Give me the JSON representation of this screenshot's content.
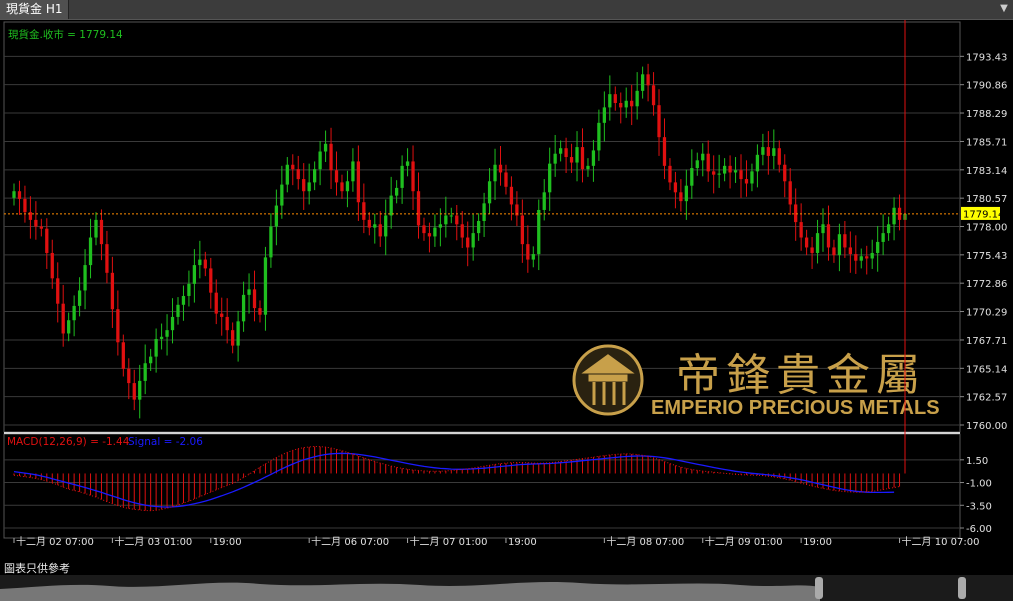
{
  "window": {
    "tab_title": "現貨金 H1"
  },
  "price_panel": {
    "readout": "現貨金.收市 = 1779.14"
  },
  "macd_panel": {
    "label_main": "MACD(12,26,9) = -1.44",
    "label_signal": "Signal = -2.06"
  },
  "watermark": {
    "brand_cn": "帝鋒貴金屬",
    "brand_en": "EMPERIO PRECIOUS METALS"
  },
  "footer": {
    "note": "圖表只供參考"
  },
  "colors": {
    "bull": "#1fbf1f",
    "bear": "#e01010",
    "macd_hist": "#e01010",
    "signal": "#1a1aff",
    "current_price": "#ffff00",
    "current_line": "#ff8c00",
    "grid": "#3a3a3a",
    "text": "#e0e0e0",
    "brand_gold": "#c8a04a"
  },
  "chart_data": [
    {
      "type": "candlestick",
      "title": "現貨金 H1",
      "series_name": "現貨金.收市",
      "current_value": 1779.14,
      "current_label": "1779.14",
      "ylim": [
        1760.0,
        1796.0
      ],
      "y_ticks": [
        1793.43,
        1790.86,
        1788.29,
        1785.71,
        1783.14,
        1780.57,
        1778.0,
        1775.43,
        1772.86,
        1770.29,
        1767.71,
        1765.14,
        1762.57,
        1760.0
      ],
      "y_tick_labels": [
        "1793.43",
        "1790.86",
        "1788.29",
        "1785.71",
        "1783.14",
        "1780.57",
        "1778.00",
        "1775.43",
        "1772.86",
        "1770.29",
        "1767.71",
        "1765.14",
        "1762.57",
        "1760.00"
      ],
      "x_ticks": [
        {
          "index": 0,
          "label": "十二月 02 07:00"
        },
        {
          "index": 18,
          "label": "十二月 03 01:00"
        },
        {
          "index": 36,
          "label": "19:00"
        },
        {
          "index": 54,
          "label": "十二月 06 07:00"
        },
        {
          "index": 72,
          "label": "十二月 07 01:00"
        },
        {
          "index": 90,
          "label": "19:00"
        },
        {
          "index": 108,
          "label": "十二月 08 07:00"
        },
        {
          "index": 126,
          "label": "十二月 09 01:00"
        },
        {
          "index": 144,
          "label": "19:00"
        },
        {
          "index": 162,
          "label": "十二月 10 07:00"
        }
      ],
      "close": [
        1781.2,
        1780.5,
        1779.3,
        1778.6,
        1778.0,
        1777.8,
        1775.6,
        1773.3,
        1771.0,
        1768.3,
        1769.5,
        1770.8,
        1772.2,
        1774.5,
        1777.0,
        1778.6,
        1776.4,
        1773.8,
        1770.5,
        1767.5,
        1765.1,
        1763.8,
        1762.3,
        1764.0,
        1765.6,
        1766.2,
        1767.8,
        1768.0,
        1768.6,
        1769.8,
        1770.9,
        1771.7,
        1772.8,
        1774.5,
        1775.0,
        1774.2,
        1772.0,
        1770.1,
        1769.8,
        1768.6,
        1767.2,
        1769.4,
        1771.8,
        1772.3,
        1770.6,
        1770.0,
        1775.2,
        1778.0,
        1779.9,
        1781.8,
        1783.6,
        1783.2,
        1782.3,
        1781.2,
        1782.0,
        1783.2,
        1784.8,
        1785.5,
        1783.1,
        1782.0,
        1781.2,
        1782.1,
        1783.9,
        1780.2,
        1778.6,
        1777.9,
        1778.2,
        1777.1,
        1779.0,
        1780.8,
        1781.5,
        1783.5,
        1783.9,
        1781.2,
        1778.1,
        1777.4,
        1777.1,
        1777.9,
        1778.2,
        1779.0,
        1779.0,
        1778.2,
        1777.0,
        1776.1,
        1777.4,
        1778.5,
        1780.1,
        1782.1,
        1783.6,
        1782.9,
        1781.6,
        1780.0,
        1779.0,
        1776.4,
        1775.0,
        1775.5,
        1779.5,
        1781.1,
        1783.7,
        1784.6,
        1785.1,
        1784.3,
        1783.8,
        1785.2,
        1783.2,
        1783.5,
        1784.9,
        1787.4,
        1788.8,
        1790.0,
        1789.2,
        1788.8,
        1789.4,
        1788.9,
        1790.3,
        1791.8,
        1790.8,
        1789.0,
        1786.1,
        1783.5,
        1782.0,
        1781.1,
        1780.3,
        1781.7,
        1783.3,
        1784.0,
        1784.6,
        1783.0,
        1782.7,
        1782.8,
        1783.5,
        1782.9,
        1783.1,
        1782.3,
        1781.9,
        1783.0,
        1784.5,
        1785.2,
        1784.4,
        1785.1,
        1783.6,
        1782.1,
        1780.0,
        1778.4,
        1777.0,
        1776.1,
        1775.6,
        1777.4,
        1778.2,
        1776.1,
        1775.4,
        1777.3,
        1776.1,
        1775.5,
        1774.9,
        1775.3,
        1775.1,
        1775.6,
        1776.6,
        1777.4,
        1778.2,
        1779.7,
        1778.6,
        1779.14
      ],
      "macd": [
        -0.2,
        -0.28,
        -0.36,
        -0.45,
        -0.55,
        -0.68,
        -0.85,
        -1.05,
        -1.25,
        -1.5,
        -1.72,
        -1.88,
        -2.02,
        -2.2,
        -2.4,
        -2.6,
        -2.85,
        -3.1,
        -3.32,
        -3.55,
        -3.72,
        -3.85,
        -3.95,
        -4.02,
        -4.08,
        -4.1,
        -4.05,
        -3.95,
        -3.82,
        -3.65,
        -3.45,
        -3.25,
        -3.05,
        -2.8,
        -2.55,
        -2.3,
        -2.05,
        -1.8,
        -1.55,
        -1.32,
        -1.1,
        -0.8,
        -0.45,
        -0.1,
        0.3,
        0.7,
        1.05,
        1.4,
        1.75,
        2.05,
        2.32,
        2.55,
        2.72,
        2.84,
        2.92,
        2.96,
        2.95,
        2.9,
        2.8,
        2.66,
        2.5,
        2.32,
        2.12,
        1.92,
        1.72,
        1.52,
        1.32,
        1.14,
        0.98,
        0.82,
        0.68,
        0.56,
        0.46,
        0.38,
        0.32,
        0.28,
        0.25,
        0.24,
        0.25,
        0.28,
        0.32,
        0.38,
        0.44,
        0.52,
        0.6,
        0.7,
        0.8,
        0.9,
        1.0,
        1.08,
        1.14,
        1.18,
        1.2,
        1.2,
        1.18,
        1.14,
        1.12,
        1.14,
        1.18,
        1.24,
        1.32,
        1.4,
        1.48,
        1.56,
        1.64,
        1.72,
        1.8,
        1.88,
        1.96,
        2.04,
        2.1,
        2.14,
        2.16,
        2.14,
        2.08,
        2.0,
        1.88,
        1.72,
        1.52,
        1.3,
        1.08,
        0.88,
        0.7,
        0.56,
        0.44,
        0.34,
        0.26,
        0.2,
        0.14,
        0.08,
        0.02,
        -0.04,
        -0.1,
        -0.14,
        -0.16,
        -0.18,
        -0.2,
        -0.24,
        -0.3,
        -0.38,
        -0.48,
        -0.6,
        -0.74,
        -0.9,
        -1.06,
        -1.22,
        -1.38,
        -1.52,
        -1.64,
        -1.76,
        -1.86,
        -1.94,
        -2.0,
        -2.04,
        -2.06,
        -2.06,
        -2.02,
        -1.96,
        -1.88,
        -1.78,
        -1.66,
        -1.54,
        -1.44
      ],
      "signal": [
        0.2,
        0.12,
        0.04,
        -0.05,
        -0.15,
        -0.28,
        -0.42,
        -0.58,
        -0.74,
        -0.9,
        -1.06,
        -1.22,
        -1.38,
        -1.55,
        -1.72,
        -1.9,
        -2.08,
        -2.28,
        -2.48,
        -2.68,
        -2.88,
        -3.06,
        -3.22,
        -3.36,
        -3.48,
        -3.58,
        -3.64,
        -3.68,
        -3.7,
        -3.68,
        -3.64,
        -3.56,
        -3.46,
        -3.34,
        -3.2,
        -3.04,
        -2.86,
        -2.66,
        -2.46,
        -2.24,
        -2.02,
        -1.78,
        -1.52,
        -1.26,
        -0.98,
        -0.7,
        -0.4,
        -0.1,
        0.2,
        0.5,
        0.78,
        1.04,
        1.28,
        1.5,
        1.68,
        1.84,
        1.98,
        2.08,
        2.16,
        2.2,
        2.22,
        2.2,
        2.16,
        2.1,
        2.02,
        1.92,
        1.82,
        1.7,
        1.58,
        1.46,
        1.34,
        1.22,
        1.1,
        0.98,
        0.88,
        0.78,
        0.7,
        0.62,
        0.56,
        0.52,
        0.48,
        0.46,
        0.46,
        0.48,
        0.5,
        0.54,
        0.58,
        0.64,
        0.7,
        0.76,
        0.82,
        0.88,
        0.94,
        0.98,
        1.02,
        1.04,
        1.06,
        1.08,
        1.1,
        1.14,
        1.18,
        1.22,
        1.28,
        1.34,
        1.4,
        1.46,
        1.52,
        1.58,
        1.64,
        1.7,
        1.76,
        1.82,
        1.86,
        1.9,
        1.92,
        1.92,
        1.9,
        1.86,
        1.8,
        1.72,
        1.62,
        1.5,
        1.38,
        1.26,
        1.14,
        1.02,
        0.9,
        0.78,
        0.66,
        0.54,
        0.44,
        0.34,
        0.24,
        0.16,
        0.08,
        0.02,
        -0.04,
        -0.1,
        -0.16,
        -0.22,
        -0.3,
        -0.38,
        -0.48,
        -0.58,
        -0.7,
        -0.82,
        -0.96,
        -1.1,
        -1.24,
        -1.38,
        -1.52,
        -1.66,
        -1.78,
        -1.88,
        -1.96,
        -2.02,
        -2.06,
        -2.08,
        -2.08,
        -2.08,
        -2.07,
        -2.06
      ],
      "macd_ylim": [
        -6.0,
        2.8
      ],
      "macd_ticks": [
        1.5,
        -1.0,
        -3.5,
        -6.0
      ],
      "macd_tick_labels": [
        "1.50",
        "-1.00",
        "-3.50",
        "-6.00"
      ]
    }
  ]
}
